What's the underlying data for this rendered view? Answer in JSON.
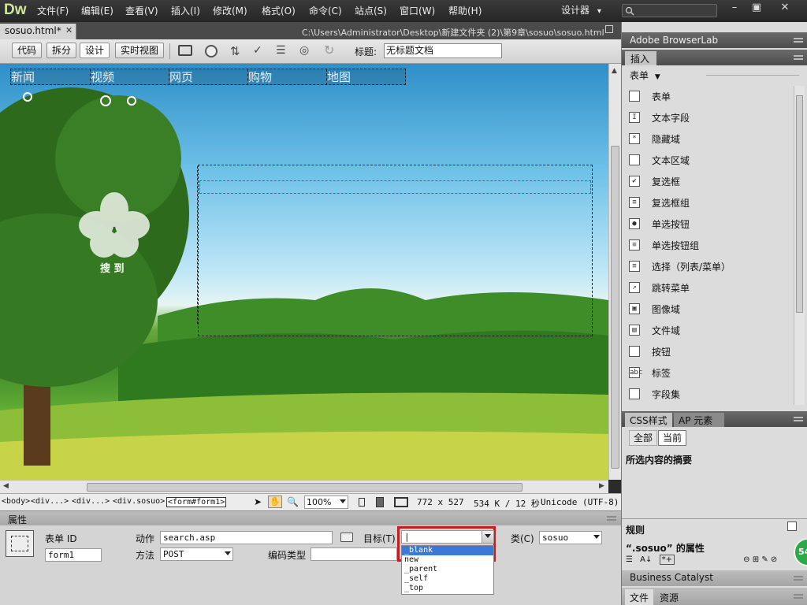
{
  "app": {
    "logo": "Dw",
    "workspace": "设计器",
    "workspace_arrow": "▾"
  },
  "menu": [
    "文件(F)",
    "编辑(E)",
    "查看(V)",
    "插入(I)",
    "修改(M)",
    "格式(O)",
    "命令(C)",
    "站点(S)",
    "窗口(W)",
    "帮助(H)"
  ],
  "search": {
    "placeholder": ""
  },
  "window": {
    "minimize": "–",
    "restore": "▣",
    "close": "✕"
  },
  "doc_tab": {
    "name": "sosuo.html*",
    "close": "✕",
    "path": "C:\\Users\\Administrator\\Desktop\\新建文件夹 (2)\\第9章\\sosuo\\sosuo.html"
  },
  "toolbar": {
    "code": "代码",
    "split": "拆分",
    "design": "设计",
    "live": "实时视图",
    "title_label": "标题:",
    "title_value": "无标题文档"
  },
  "page": {
    "nav": [
      "新闻",
      "视频",
      "网页",
      "购物",
      "地图"
    ],
    "logo_text": "搜 到"
  },
  "status": {
    "tags": [
      "<body>",
      "<div...>",
      "<div...>",
      "<div.sosuo>",
      "<form#form1>"
    ],
    "zoom": "100%",
    "size": "772 x 527",
    "weight": "534 K / 12 秒",
    "encoding": "Unicode (UTF-8)"
  },
  "properties": {
    "panel_title": "属性",
    "form_id_label": "表单 ID",
    "form_id_value": "form1",
    "action_label": "动作",
    "action_value": "search.asp",
    "method_label": "方法",
    "method_value": "POST",
    "enctype_label": "编码类型",
    "target_label": "目标(T)",
    "target_value": "|",
    "target_options": [
      "_blank",
      "new",
      "_parent",
      "_self",
      "_top"
    ],
    "class_label": "类(C)",
    "class_value": "sosuo"
  },
  "right_panel": {
    "browserlab": "Adobe BrowserLab",
    "insert_tab": "插入",
    "insert_category": "表单",
    "insert_items": [
      {
        "icon": "form-icon",
        "glyph": "",
        "label": "表单"
      },
      {
        "icon": "text-field-icon",
        "glyph": "I",
        "label": "文本字段"
      },
      {
        "icon": "hidden-field-icon",
        "glyph": "*",
        "label": "隐藏域"
      },
      {
        "icon": "textarea-icon",
        "glyph": "",
        "label": "文本区域"
      },
      {
        "icon": "checkbox-icon",
        "glyph": "✔",
        "label": "复选框"
      },
      {
        "icon": "checkbox-group-icon",
        "glyph": "≡",
        "label": "复选框组"
      },
      {
        "icon": "radio-button-icon",
        "glyph": "●",
        "label": "单选按钮"
      },
      {
        "icon": "radio-group-icon",
        "glyph": "≡",
        "label": "单选按钮组"
      },
      {
        "icon": "select-list-icon",
        "glyph": "≡",
        "label": "选择（列表/菜单）"
      },
      {
        "icon": "jump-menu-icon",
        "glyph": "↗",
        "label": "跳转菜单"
      },
      {
        "icon": "image-field-icon",
        "glyph": "▣",
        "label": "图像域"
      },
      {
        "icon": "file-field-icon",
        "glyph": "▤",
        "label": "文件域"
      },
      {
        "icon": "button-icon",
        "glyph": "",
        "label": "按钮"
      },
      {
        "icon": "label-icon",
        "glyph": "abc",
        "label": "标签"
      },
      {
        "icon": "fieldset-icon",
        "glyph": "",
        "label": "字段集"
      }
    ],
    "css_tab": "CSS样式",
    "ap_tab": "AP 元素",
    "all_btn": "全部",
    "current_btn": "当前",
    "summary_title": "所选内容的摘要",
    "rules_title": "规则",
    "props_title": "“.sosuo” 的属性",
    "badge": "54",
    "business_catalyst": "Business Catalyst",
    "files_tab": "文件",
    "assets_tab": "资源"
  }
}
